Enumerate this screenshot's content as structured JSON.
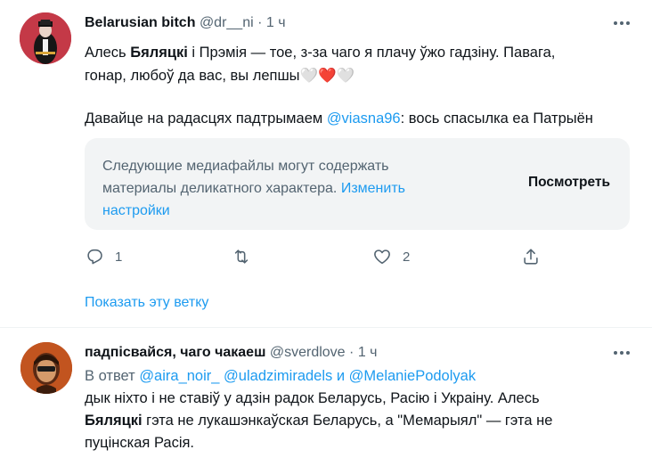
{
  "tweet1": {
    "author_name": "Belarusian bitch",
    "handle": "@dr__ni",
    "separator": "·",
    "time": "1 ч",
    "text": {
      "l1_part1": "Алесь ",
      "l1_bold": "Бяляцкі",
      "l1_part2": " і Прэмія — тое, з-за чаго я плачу ўжо гадзіну. Павага,",
      "l2": "гонар, любоў да вас, вы лепшы",
      "hearts": "🤍❤️🤍",
      "l3_part1": "Давайце на радасцях падтрымаем ",
      "l3_mention": "@viasna96",
      "l3_part2": ": вось спасылка еа Патрыён"
    },
    "sensitive": {
      "line1": "Следующие медиафайлы могут содержать",
      "line2_part1": "материалы деликатного характера. ",
      "line2_link": "Изменить",
      "line3_link": "настройки",
      "view_button": "Посмотреть"
    },
    "actions": {
      "reply_count": "1",
      "retweet_count": "",
      "like_count": "2"
    },
    "show_thread": "Показать эту ветку"
  },
  "tweet2": {
    "author_name": "падпісвайся, чаго чакаеш",
    "handle": "@sverdlove",
    "separator": "·",
    "time": "1 ч",
    "reply_prefix": "В ответ ",
    "reply_mention1": "@aira_noir_",
    "reply_mention2": "@uladzimiradels",
    "reply_and": " и ",
    "reply_mention3": "@MelaniePodolyak",
    "text": {
      "l1": "дык ніхто і не ставіў у адзін радок Беларусь, Расію і Украіну. Алесь",
      "l2_bold": "Бяляцкі",
      "l2_rest": " гэта не лукашэнкаўская Беларусь, а \"Мемарыял\" — гэта не",
      "l3": "пуцінская Расія."
    }
  },
  "colors": {
    "accent": "#1d9bf0",
    "secondary_text": "#536471",
    "primary_text": "#0f1419",
    "sensitive_bg": "#f2f4f5",
    "heart_red": "#e0245e"
  },
  "icons": {
    "more": "more-horizontal-icon",
    "reply": "reply-icon",
    "retweet": "retweet-icon",
    "like": "heart-icon",
    "share": "share-icon"
  }
}
